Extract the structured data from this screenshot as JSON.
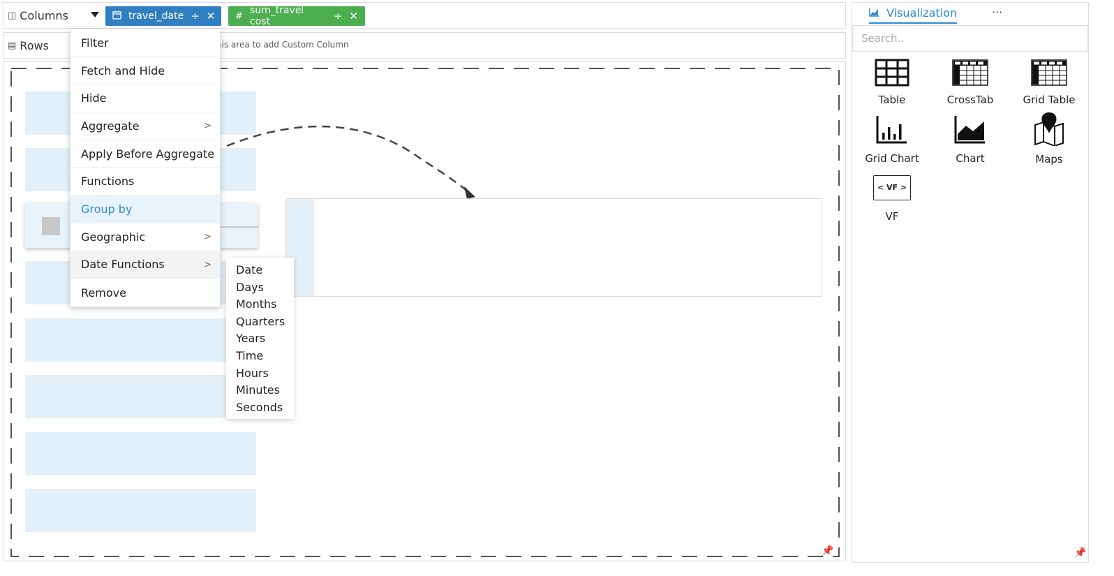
{
  "columns_bar": {
    "label": "Columns",
    "pills": [
      {
        "label": "travel_date",
        "type_icon": "calendar-icon",
        "color": "#2f7fc1"
      },
      {
        "label": "sum_travel cost",
        "type_icon": "hash-icon",
        "color": "#4cae4f"
      }
    ]
  },
  "rows_bar": {
    "label": "Rows",
    "hint": "his area to add Custom Column"
  },
  "context_menu": {
    "items": [
      {
        "label": "Filter"
      },
      {
        "label": "Fetch and Hide"
      },
      {
        "label": "Hide"
      },
      {
        "label": "Aggregate",
        "has_submenu": true
      },
      {
        "label": "Apply Before Aggregate"
      },
      {
        "label": "Functions"
      },
      {
        "label": "Group by",
        "selected": true
      },
      {
        "label": "Geographic",
        "has_submenu": true
      },
      {
        "label": "Date Functions",
        "has_submenu": true,
        "hovered": true
      },
      {
        "label": "Remove"
      }
    ]
  },
  "date_submenu": {
    "items": [
      "Date",
      "Days",
      "Months",
      "Quarters",
      "Years",
      "Time",
      "Hours",
      "Minutes",
      "Seconds"
    ]
  },
  "right_panel": {
    "tab_label": "Visualization",
    "more_label": "···",
    "search_placeholder": "Search..",
    "items": [
      {
        "label": "Table",
        "icon": "table-icon"
      },
      {
        "label": "CrossTab",
        "icon": "crosstab-icon"
      },
      {
        "label": "Grid Table",
        "icon": "grid-table-icon"
      },
      {
        "label": "Grid Chart",
        "icon": "grid-chart-icon"
      },
      {
        "label": "Chart",
        "icon": "chart-icon"
      },
      {
        "label": "Maps",
        "icon": "maps-icon"
      },
      {
        "label": "VF",
        "icon": "vf-icon"
      }
    ],
    "vf_icon_text": "< VF >"
  },
  "colors": {
    "accent": "#2d8ad6",
    "date_pill": "#2f7fc1",
    "measure_pill": "#4cae4f",
    "placeholder_block": "#e3f0fa"
  }
}
